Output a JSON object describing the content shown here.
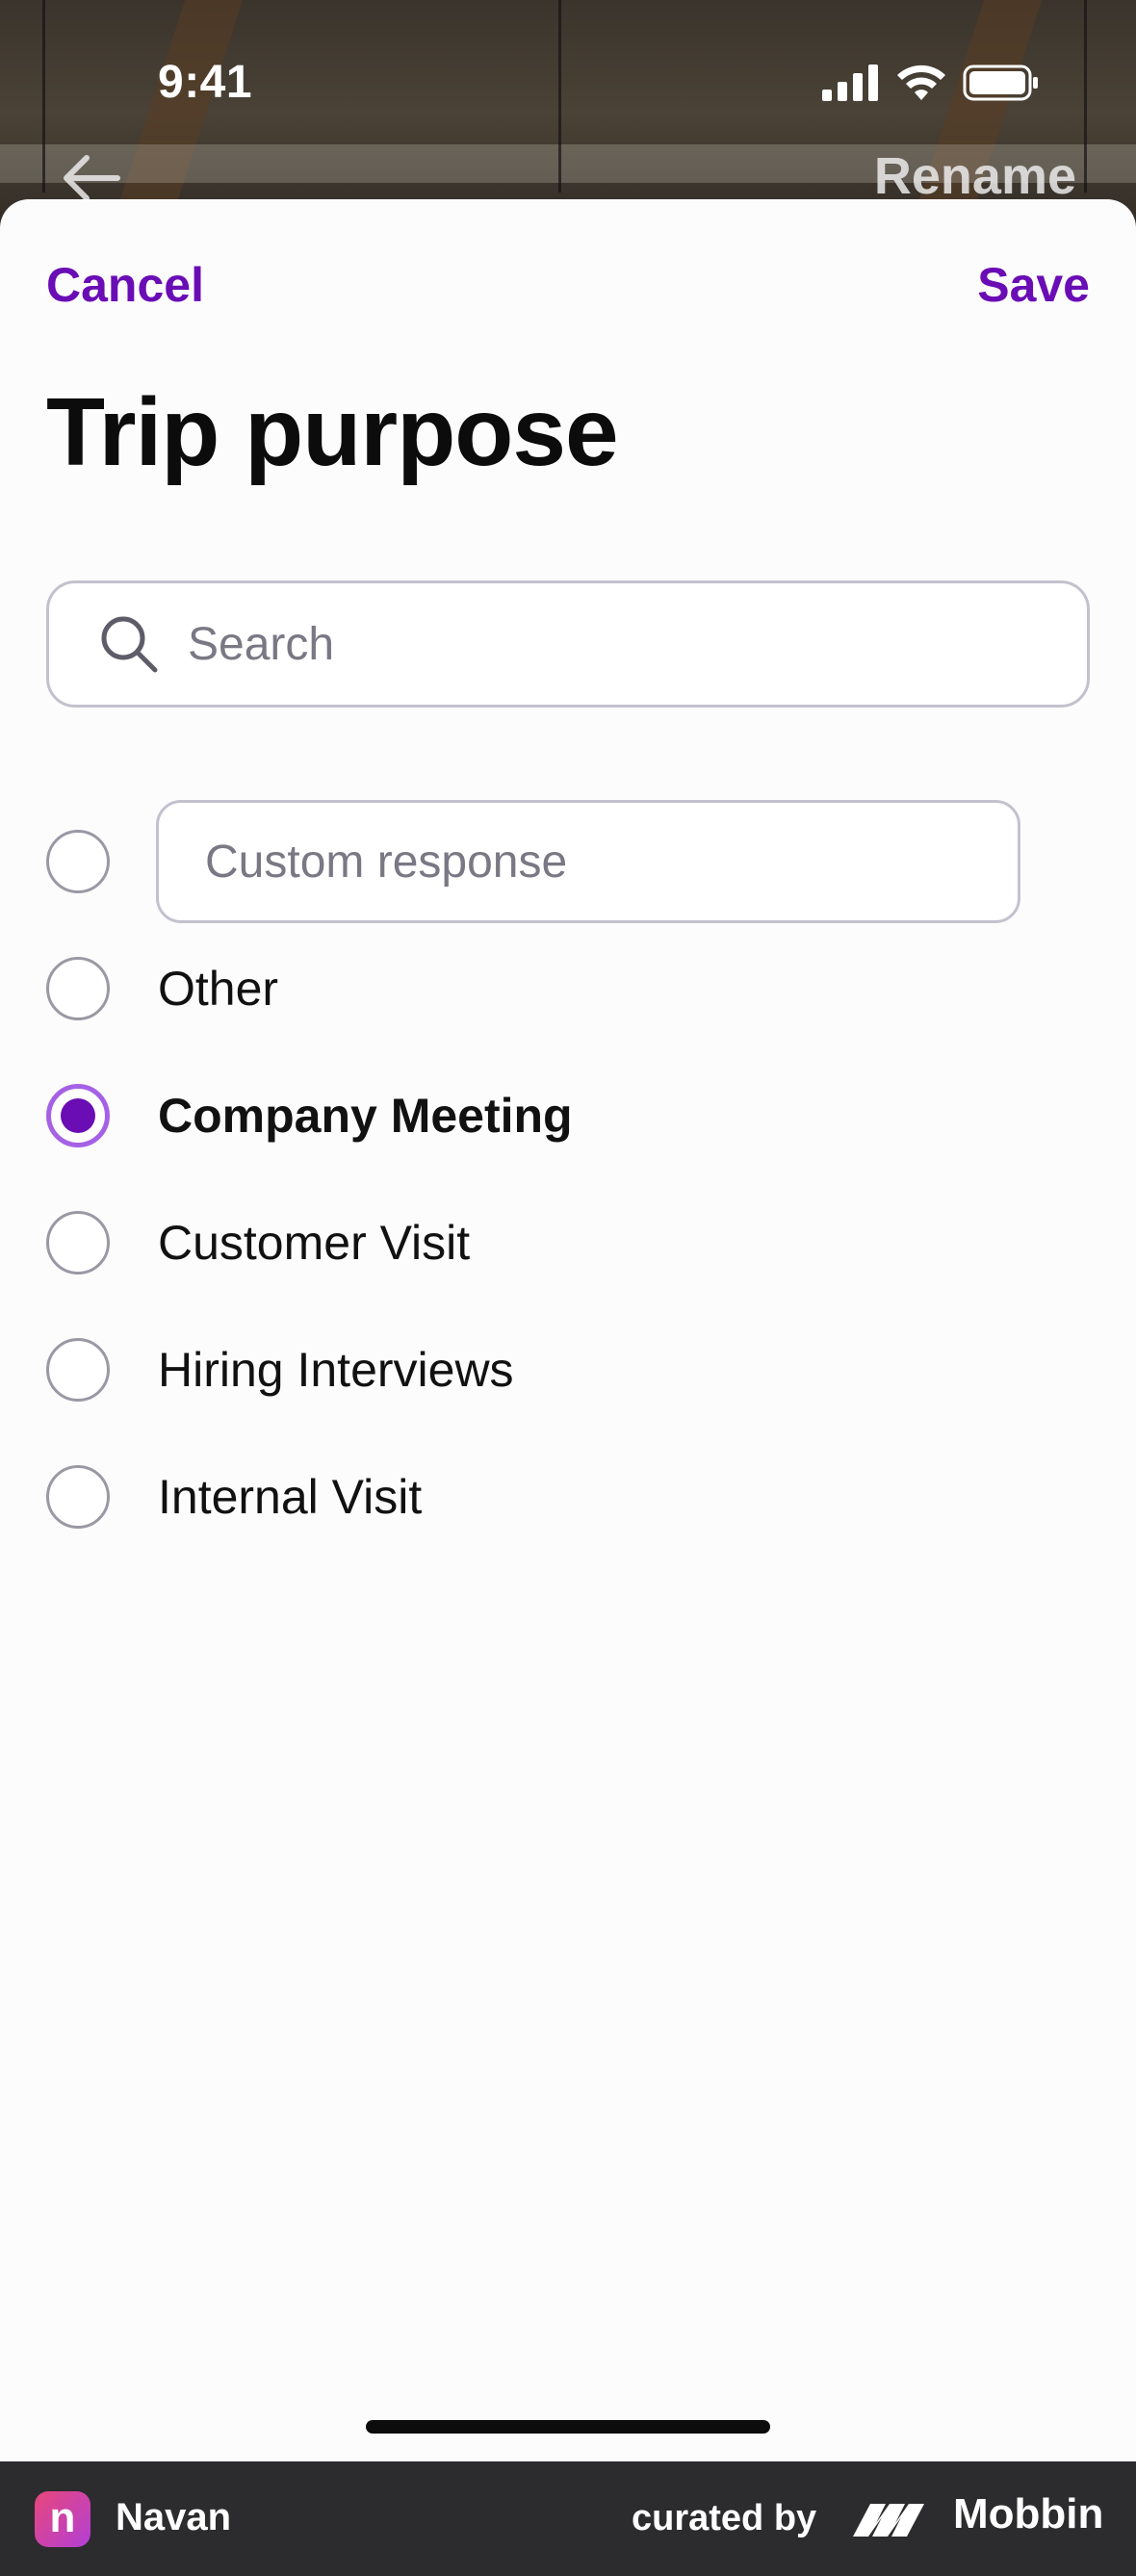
{
  "status_bar": {
    "time": "9:41"
  },
  "background_nav": {
    "action_label": "Rename"
  },
  "header": {
    "cancel_label": "Cancel",
    "save_label": "Save"
  },
  "title": "Trip purpose",
  "search": {
    "placeholder": "Search",
    "value": ""
  },
  "custom_response": {
    "placeholder": "Custom response",
    "value": ""
  },
  "options": [
    {
      "label": "Other",
      "selected": false
    },
    {
      "label": "Company Meeting",
      "selected": true
    },
    {
      "label": "Customer Visit",
      "selected": false
    },
    {
      "label": "Hiring Interviews",
      "selected": false
    },
    {
      "label": "Internal Visit",
      "selected": false
    }
  ],
  "footer": {
    "app_initial": "n",
    "app_name": "Navan",
    "curated_by": "curated by",
    "brand": "Mobbin"
  },
  "colors": {
    "accent": "#6a0db5",
    "radio_ring_selected": "#a561e6",
    "footer_bg": "#2c2b2d"
  },
  "icons": [
    "signal-icon",
    "wifi-icon",
    "battery-icon",
    "back-arrow-icon",
    "search-icon",
    "mobbin-logo-icon"
  ]
}
